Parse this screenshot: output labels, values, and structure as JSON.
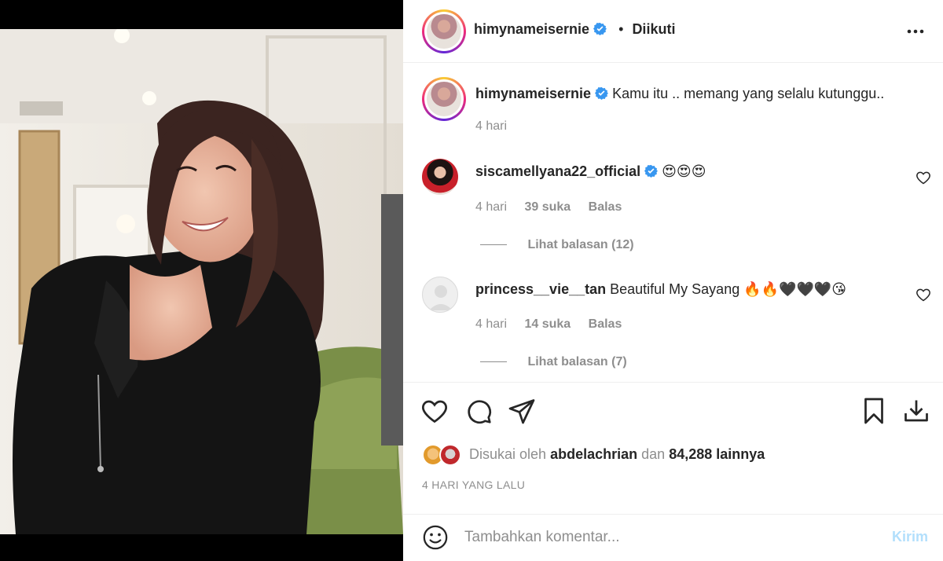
{
  "post": {
    "author": "himynameisernie",
    "follow_status": "Diikuti",
    "separator": "•",
    "caption": "Kamu itu .. memang yang selalu kutunggu..",
    "caption_time": "4 hari"
  },
  "comments": [
    {
      "user": "siscamellyana22_official",
      "verified": true,
      "text": "😍😍😍",
      "time": "4 hari",
      "likes": "39 suka",
      "reply_label": "Balas",
      "view_replies": "Lihat balasan (12)"
    },
    {
      "user": "princess__vie__tan",
      "verified": false,
      "text": "Beautiful My Sayang 🔥🔥🖤🖤🖤😘",
      "time": "4 hari",
      "likes": "14 suka",
      "reply_label": "Balas",
      "view_replies": "Lihat balasan (7)"
    }
  ],
  "likes_line": {
    "prefix": "Disukai oleh",
    "user": "abdelachrian",
    "middle": "dan",
    "count": "84,288 lainnya"
  },
  "posted_date": "4 HARI YANG LALU",
  "composer": {
    "placeholder": "Tambahkan komentar...",
    "post_label": "Kirim"
  },
  "colors": {
    "text": "#262626",
    "muted": "#8e8e8e",
    "verified": "#3897f0",
    "post_disabled": "#b2dffc"
  },
  "icons": [
    "more-icon",
    "verified-icon",
    "heart-icon",
    "comment-icon",
    "share-icon",
    "bookmark-icon",
    "download-icon",
    "emoji-icon"
  ]
}
